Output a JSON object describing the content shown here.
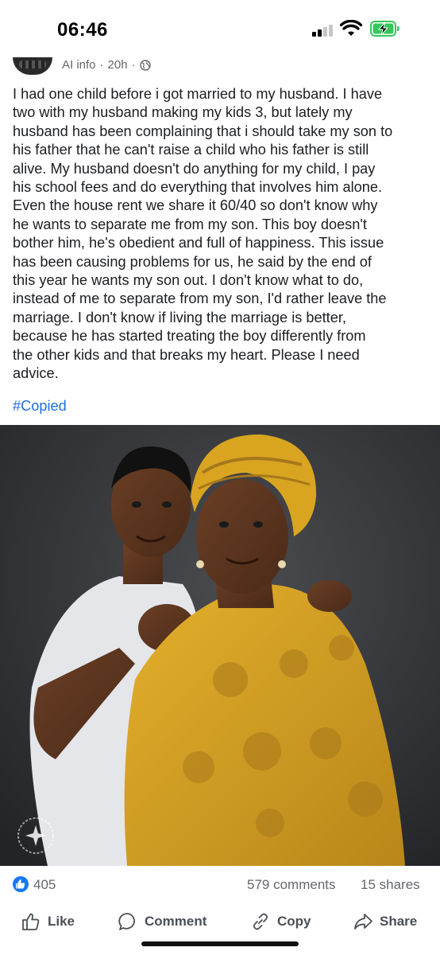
{
  "status_bar": {
    "time": "06:46",
    "icons": [
      "cellular-signal-icon",
      "wifi-icon",
      "battery-charging-icon"
    ]
  },
  "post": {
    "author": "AI info",
    "time": "20h",
    "separator": "·",
    "audience_icon": "globe-icon",
    "body": "I had one child before i got married to my husband. I have\ntwo with my husband making my kids 3, but lately my\nhusband has been complaining that i should take my son to\nhis father that he can't raise a child who his father is still\nalive. My husband doesn't do anything for my child, I pay\nhis school fees and do everything that involves him alone.\nEven the house rent we share it 60/40 so don't know why\nhe wants to separate me from my son. This boy doesn't\nbother him, he's obedient and full of happiness. This issue\nhas been causing problems for us, he said by the end of\nthis year he wants my son out. I don't know what to do,\ninstead of me to separate from my son, I'd rather leave the\nmarriage. I don't know if living the marriage is better,\nbecause he has started treating the boy differently from\nthe other kids and that breaks my heart. Please I  need\nadvice.",
    "hashtag": "#Copied",
    "image_icon": "ai-generated-photo-mother-and-son"
  },
  "stats": {
    "reaction_icon": "like-icon",
    "reactions": "405",
    "comments": "579 comments",
    "shares": "15 shares"
  },
  "actions": {
    "like": "Like",
    "comment": "Comment",
    "copy": "Copy",
    "share": "Share"
  },
  "colors": {
    "link": "#216fdb",
    "like_blue": "#1877f2",
    "meta_gray": "#65676b",
    "battery_green": "#34c759",
    "dress_yellow": "#d9a521"
  }
}
